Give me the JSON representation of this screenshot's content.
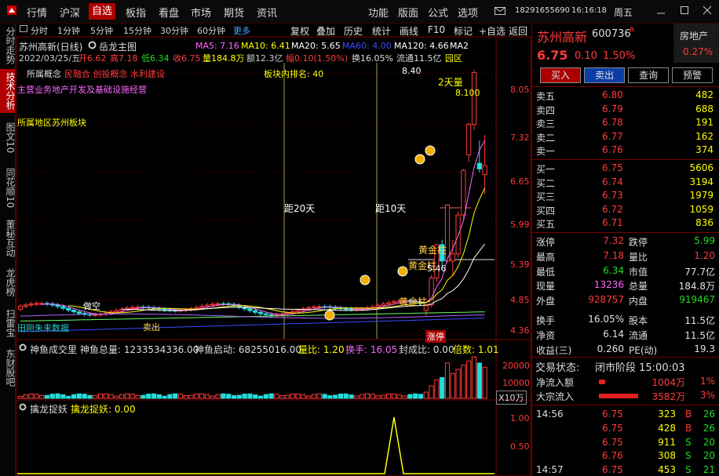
{
  "menu": {
    "items": [
      "行情",
      "沪深",
      "自选",
      "板指",
      "看盘",
      "市场",
      "期货",
      "资讯"
    ],
    "active": "自选",
    "right_items": [
      "功能",
      "版面",
      "公式",
      "选项"
    ],
    "phone": "18291655690",
    "time": "16:16:18",
    "weekday": "周五"
  },
  "side_tabs": [
    "分时走势",
    "技术分析",
    "图文10",
    "同花顺10",
    "董秘互动",
    "龙虎榜",
    "扫雷宝",
    "东财股吧"
  ],
  "side_active": "技术分析",
  "periods": [
    "分时",
    "1分钟",
    "5分钟",
    "15分钟",
    "30分钟",
    "60分钟",
    "更多"
  ],
  "toolbar": [
    "复权",
    "叠加",
    "历史",
    "统计",
    "画线",
    "F10",
    "标记",
    "+自选",
    "返回"
  ],
  "chart": {
    "title": "苏州高新(日线)",
    "indicator_name": "岳龙主图",
    "ma": [
      {
        "label": "MA5: 7.16",
        "color": "#ff66ff"
      },
      {
        "label": "MA10: 6.41",
        "color": "#ffff00"
      },
      {
        "label": "MA20: 5.65",
        "color": "#ffffff"
      },
      {
        "label": "MA60: 4.00",
        "color": "#3a4bff"
      },
      {
        "label": "MA120: 4.66",
        "color": "#ffffff"
      },
      {
        "label": "MA2",
        "color": "#ffffff"
      }
    ],
    "info_line": {
      "date": "2022/03/25/五",
      "open": "开6.62",
      "high": "高7.18",
      "low": "低6.34",
      "close": "收6.75",
      "vol": "量184.8万",
      "amount": "额12.3亿",
      "change": "幅0.10(1.50%)",
      "turnover": "换16.05%",
      "float": "流通11.5亿",
      "zone": "园区"
    },
    "concepts_label": "所属概念",
    "concepts": "民融合 创投概念 水利建设",
    "main_business": "主营业务地产开发及基础设施经营",
    "region": "所属地区苏州板块",
    "sector_rank": "板块内排名: 40",
    "annotations": {
      "two_day": "2天量",
      "high_val": "8.100",
      "high_label": "8.40",
      "dist20": "距20天",
      "dist10": "距10天",
      "gold1": "黄金柱",
      "gold2": "黄金柱",
      "gold3": "黄金柱",
      "val546": "5.46",
      "doukong": "做空",
      "sell": "卖出",
      "zhangting": "涨停",
      "cyan_text": "田刚朱来数据"
    },
    "price_axis": [
      "8.05",
      "7.32",
      "6.65",
      "5.99",
      "5.39",
      "4.85",
      "4.36"
    ]
  },
  "volume_panel": {
    "title": "神鱼成交里",
    "total": "神鱼总量: 1233534336.00",
    "start": "神鱼启动: 68255016.00",
    "ratio": "量比: 1.20",
    "turnover": "换手: 16.05",
    "seal": "封成比: 0.00",
    "multiple": "倍数: 1.01",
    "axis": [
      "20000",
      "10000",
      "X10万"
    ]
  },
  "dragon_panel": {
    "title": "擒龙捉妖",
    "value": "擒龙捉妖: 0.00",
    "axis": [
      "1.00",
      "0.50"
    ]
  },
  "chart_data": {
    "type": "candlestick",
    "title": "苏州高新(日线)",
    "candles_recent": [
      {
        "o": 4.7,
        "h": 4.8,
        "l": 4.62,
        "c": 4.78
      },
      {
        "o": 4.78,
        "h": 5.2,
        "l": 4.75,
        "c": 5.16
      },
      {
        "o": 5.16,
        "h": 5.63,
        "l": 5.1,
        "c": 5.63
      },
      {
        "o": 5.63,
        "h": 5.7,
        "l": 5.3,
        "c": 5.4
      },
      {
        "o": 5.4,
        "h": 6.2,
        "l": 5.38,
        "c": 6.19
      },
      {
        "o": 5.4,
        "h": 5.7,
        "l": 5.2,
        "c": 5.5
      },
      {
        "o": 5.5,
        "h": 6.1,
        "l": 5.45,
        "c": 6.05
      },
      {
        "o": 6.05,
        "h": 6.7,
        "l": 6.0,
        "c": 6.68
      },
      {
        "o": 6.9,
        "h": 7.35,
        "l": 6.8,
        "c": 7.33
      },
      {
        "o": 7.33,
        "h": 8.1,
        "l": 7.25,
        "c": 8.06
      },
      {
        "o": 6.78,
        "h": 7.1,
        "l": 6.65,
        "c": 6.7
      },
      {
        "o": 6.62,
        "h": 7.18,
        "l": 6.34,
        "c": 6.75
      }
    ],
    "ylim": [
      4.3,
      8.2
    ]
  },
  "stock": {
    "name": "苏州高新",
    "code": "600736",
    "mark": "R",
    "sector": "房地产",
    "sector_pct": "0.27%",
    "price": "6.75",
    "change": "0.10",
    "pct": "1.50%",
    "buttons": [
      "买入",
      "卖出",
      "查询",
      "预警"
    ]
  },
  "order_book": {
    "sell": [
      {
        "label": "卖五",
        "price": "6.80",
        "vol": "482"
      },
      {
        "label": "卖四",
        "price": "6.79",
        "vol": "688"
      },
      {
        "label": "卖三",
        "price": "6.78",
        "vol": "191"
      },
      {
        "label": "卖二",
        "price": "6.77",
        "vol": "162"
      },
      {
        "label": "卖一",
        "price": "6.76",
        "vol": "374"
      }
    ],
    "buy": [
      {
        "label": "买一",
        "price": "6.75",
        "vol": "5606"
      },
      {
        "label": "买二",
        "price": "6.74",
        "vol": "3194"
      },
      {
        "label": "买三",
        "price": "6.73",
        "vol": "1979"
      },
      {
        "label": "买四",
        "price": "6.72",
        "vol": "1059"
      },
      {
        "label": "买五",
        "price": "6.71",
        "vol": "836"
      }
    ]
  },
  "stats": [
    {
      "l1": "涨停",
      "v1": "7.32",
      "c1": "#ff3b3b",
      "l2": "跌停",
      "v2": "5.99",
      "c2": "#22dd22"
    },
    {
      "l1": "最高",
      "v1": "7.18",
      "c1": "#ff3b3b",
      "l2": "量比",
      "v2": "1.20",
      "c2": "#ff3b3b"
    },
    {
      "l1": "最低",
      "v1": "6.34",
      "c1": "#22dd22",
      "l2": "市值",
      "v2": "77.7亿",
      "c2": "#e0e0e0"
    },
    {
      "l1": "现量",
      "v1": "13236",
      "c1": "#ff66ff",
      "l2": "总量",
      "v2": "184.8万",
      "c2": "#e0e0e0"
    },
    {
      "l1": "外盘",
      "v1": "928757",
      "c1": "#ff3b3b",
      "l2": "内盘",
      "v2": "919467",
      "c2": "#22dd22"
    },
    {
      "l1": "换手",
      "v1": "16.05%",
      "c1": "#e0e0e0",
      "l2": "股本",
      "v2": "11.5亿",
      "c2": "#e0e0e0"
    },
    {
      "l1": "净资",
      "v1": "6.14",
      "c1": "#e0e0e0",
      "l2": "流通",
      "v2": "11.5亿",
      "c2": "#e0e0e0"
    },
    {
      "l1": "收益(三)",
      "v1": "0.260",
      "c1": "#e0e0e0",
      "l2": "PE(动)",
      "v2": "19.3",
      "c2": "#e0e0e0"
    }
  ],
  "trade_status": {
    "label": "交易状态:",
    "value": "闭市阶段 15:00:03"
  },
  "flows": [
    {
      "label": "净流入额",
      "value": "1004万",
      "pct": "1%",
      "fill": 0.12
    },
    {
      "label": "大宗流入",
      "value": "3582万",
      "pct": "3%",
      "fill": 0.72
    }
  ],
  "ticks": [
    {
      "time": "14:56",
      "price": "6.75",
      "vol": "323",
      "side": "B",
      "n": "26"
    },
    {
      "time": "",
      "price": "6.75",
      "vol": "428",
      "side": "B",
      "n": "26"
    },
    {
      "time": "",
      "price": "6.75",
      "vol": "911",
      "side": "S",
      "n": "20"
    },
    {
      "time": "",
      "price": "6.76",
      "vol": "308",
      "side": "S",
      "n": "20"
    },
    {
      "time": "14:57",
      "price": "6.75",
      "vol": "453",
      "side": "S",
      "n": "21"
    }
  ]
}
